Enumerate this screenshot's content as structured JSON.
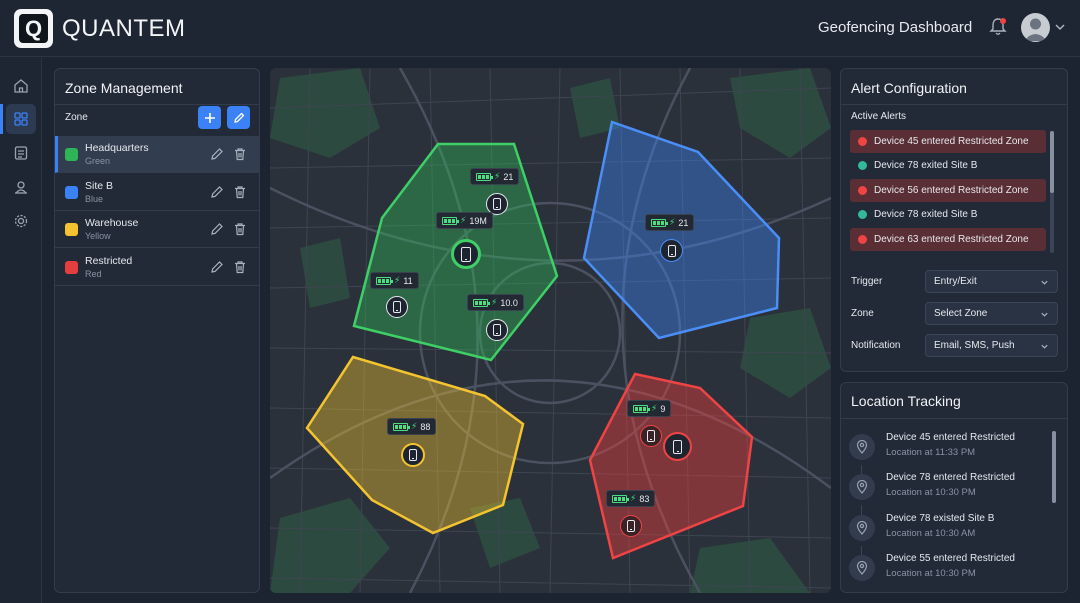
{
  "app": {
    "brand": "QUANTEM",
    "logo_letter": "Q",
    "page_title": "Geofencing Dashboard"
  },
  "zones": {
    "title": "Zone Management",
    "column_label": "Zone",
    "items": [
      {
        "name": "Headquarters",
        "color_name": "Green",
        "color": "#2fb457",
        "selected": true
      },
      {
        "name": "Site B",
        "color_name": "Blue",
        "color": "#3b82f6",
        "selected": false
      },
      {
        "name": "Warehouse",
        "color_name": "Yellow",
        "color": "#f4c430",
        "selected": false
      },
      {
        "name": "Restricted",
        "color_name": "Red",
        "color": "#e53e3e",
        "selected": false
      }
    ]
  },
  "map": {
    "devices": [
      {
        "label": "21"
      },
      {
        "label": "19M"
      },
      {
        "label": "11"
      },
      {
        "label": "10.0"
      },
      {
        "label": "21"
      },
      {
        "label": "88"
      },
      {
        "label": "9"
      },
      {
        "label": "83"
      }
    ]
  },
  "alerts": {
    "title": "Alert Configuration",
    "active_label": "Active Alerts",
    "items": [
      {
        "text": "Device 45 entered Restricted Zone",
        "type": "danger"
      },
      {
        "text": "Device 78 exited Site B",
        "type": "info"
      },
      {
        "text": "Device 56 entered Restricted Zone",
        "type": "danger"
      },
      {
        "text": "Device 78 exited Site B",
        "type": "info"
      },
      {
        "text": "Device 63 entered Restricted Zone",
        "type": "danger"
      }
    ],
    "form": {
      "trigger_label": "Trigger",
      "trigger_value": "Entry/Exit",
      "zone_label": "Zone",
      "zone_value": "Select Zone",
      "notification_label": "Notification",
      "notification_value": "Email, SMS, Push"
    }
  },
  "tracking": {
    "title": "Location Tracking",
    "items": [
      {
        "title": "Device 45 entered Restricted",
        "sub": "Location at 11:33 PM"
      },
      {
        "title": "Device 78 entered Restricted",
        "sub": "Location at 10:30 PM"
      },
      {
        "title": "Device 78 existed Site B",
        "sub": "Location at 10:30 AM"
      },
      {
        "title": "Device 55 entered Restricted",
        "sub": "Location at 10:30 PM"
      }
    ]
  },
  "colors": {
    "accent": "#3b82f6",
    "danger": "#ef4444",
    "success": "#4ade80",
    "info": "#34b89a"
  },
  "icons": [
    "home-icon",
    "grid-icon",
    "list-icon",
    "user-pin-icon",
    "gear-icon",
    "bell-icon",
    "plus-icon",
    "pencil-icon",
    "trash-icon",
    "battery-icon",
    "bolt-icon",
    "phone-icon",
    "map-pin-icon",
    "chevron-down-icon"
  ]
}
